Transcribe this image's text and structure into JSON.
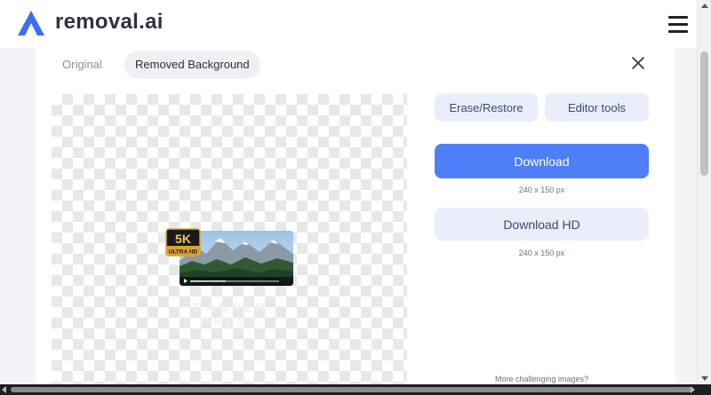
{
  "header": {
    "logo_text": "removal.ai",
    "logo_icon": "removal-logo-icon",
    "menu_icon": "hamburger-menu-icon"
  },
  "tabs": {
    "original_label": "Original",
    "removed_label": "Removed Background"
  },
  "preview": {
    "badge_line1": "5K",
    "badge_line2": "ULTRA HD",
    "watermark": "BANNER PRESS"
  },
  "actions": {
    "erase_label": "Erase/Restore",
    "editor_label": "Editor tools",
    "download_label": "Download",
    "download_size": "240 x 150 px",
    "download_hd_label": "Download HD",
    "download_hd_size": "240 x 150 px",
    "challenge_text": "More challenging images?"
  },
  "colors": {
    "accent": "#4f7ff8",
    "secondary_bg": "#e9eefa",
    "secondary_text": "#3b4a78",
    "logo_blue": "#3c6ef5"
  }
}
